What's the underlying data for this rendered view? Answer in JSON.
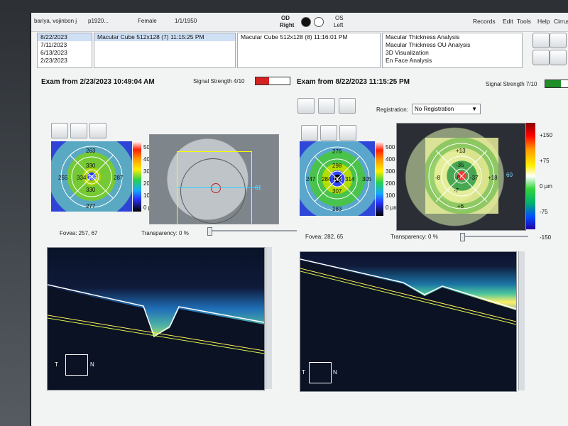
{
  "header": {
    "patient_name": "bariya, vojinbon j",
    "patient_id": "p1920...",
    "sex": "Female",
    "dob": "1/1/1950",
    "eye_right_top": "OD",
    "eye_right_bottom": "Right",
    "eye_left_top": "OS",
    "eye_left_bottom": "Left",
    "menus": [
      "Records",
      "Edit",
      "Tools",
      "Help",
      "Cirrus"
    ]
  },
  "exam_dates": [
    "8/22/2023",
    "7/11/2023",
    "6/13/2023",
    "2/23/2023"
  ],
  "scan_items": {
    "left": "Macular Cube 512x128 (7) 11:15:25 PM",
    "right": "Macular Cube 512x128 (8) 11:16:01 PM"
  },
  "analysis_items": [
    "Macular Thickness Analysis",
    "Macular Thickness OU Analysis",
    "3D Visualization",
    "En Face Analysis"
  ],
  "left_exam": {
    "title": "Exam from 2/23/2023 10:49:04 AM",
    "signal_label": "Signal Strength 4/10",
    "signal_value": 0.4,
    "thickness_values": [
      "263",
      "330",
      "255",
      "334",
      "336",
      "287",
      "277",
      "330"
    ],
    "fovea": "Fovea: 257, 67",
    "transparency": "Transparency:  0 %",
    "scale_labels": [
      "500",
      "400",
      "300",
      "200",
      "100",
      "0 µm"
    ],
    "scan_marker": "61",
    "orientation_t": "T",
    "orientation_n": "N"
  },
  "right_exam": {
    "title": "Exam from 8/22/2023 11:15:25 PM",
    "signal_label": "Signal Strength 7/10",
    "signal_value": 0.7,
    "registration_label": "Registration:",
    "registration_value": "No Registration",
    "thickness_values": [
      "276",
      "298",
      "247",
      "284",
      "174",
      "314",
      "305",
      "307",
      "283"
    ],
    "fovea": "Fovea: 282, 65",
    "transparency": "Transparency:  0 %",
    "scale_labels": [
      "500",
      "400",
      "300",
      "200",
      "100",
      "0 µm"
    ],
    "change_scale": [
      "+150",
      "+75",
      "0 µm",
      "-75",
      "-150"
    ],
    "change_values": [
      "+13",
      "-35",
      "-8",
      "-37",
      "+18",
      "+6",
      "-7",
      "-8"
    ],
    "scan_marker": "60",
    "orientation_t": "T",
    "orientation_n": "N"
  }
}
